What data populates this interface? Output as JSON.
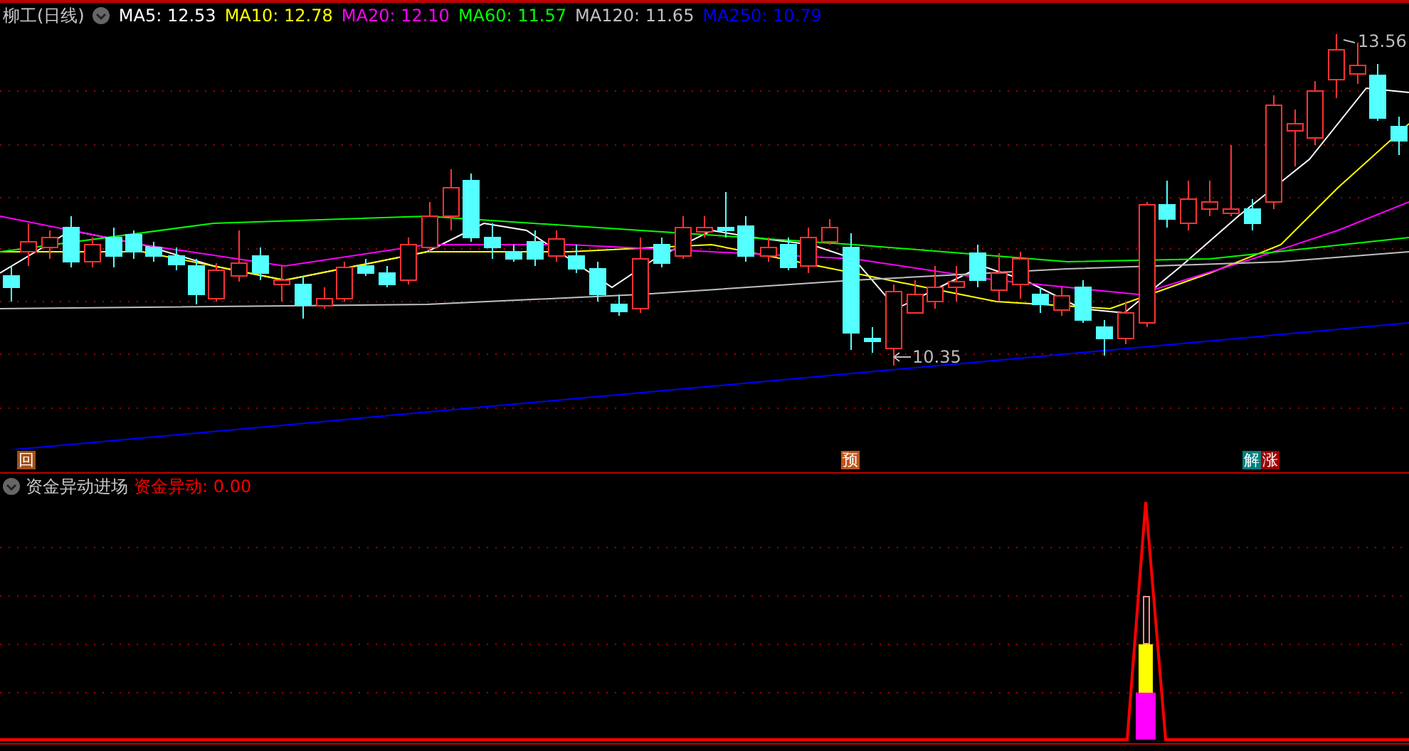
{
  "chart": {
    "title": "柳工(日线)",
    "moving_averages": [
      {
        "label": "MA5:",
        "value": "12.53",
        "color": "#ffffff"
      },
      {
        "label": "MA10:",
        "value": "12.78",
        "color": "#ffff00"
      },
      {
        "label": "MA20:",
        "value": "12.10",
        "color": "#ff00ff"
      },
      {
        "label": "MA60:",
        "value": "11.57",
        "color": "#00ff00"
      },
      {
        "label": "MA120:",
        "value": "11.65",
        "color": "#c0c0c0"
      },
      {
        "label": "MA250:",
        "value": "10.79",
        "color": "#0000ff"
      }
    ],
    "high_label": "13.56",
    "low_label": "10.35"
  },
  "markers": [
    {
      "text": "回",
      "color": "#a0501a"
    },
    {
      "text": "预",
      "color": "#c0541a"
    },
    {
      "text": "解",
      "color": "#008080"
    },
    {
      "text": "涨",
      "color": "#a00000"
    }
  ],
  "indicator": {
    "title": "资金异动进场",
    "series_label": "资金异动:",
    "series_value": "0.00"
  }
}
